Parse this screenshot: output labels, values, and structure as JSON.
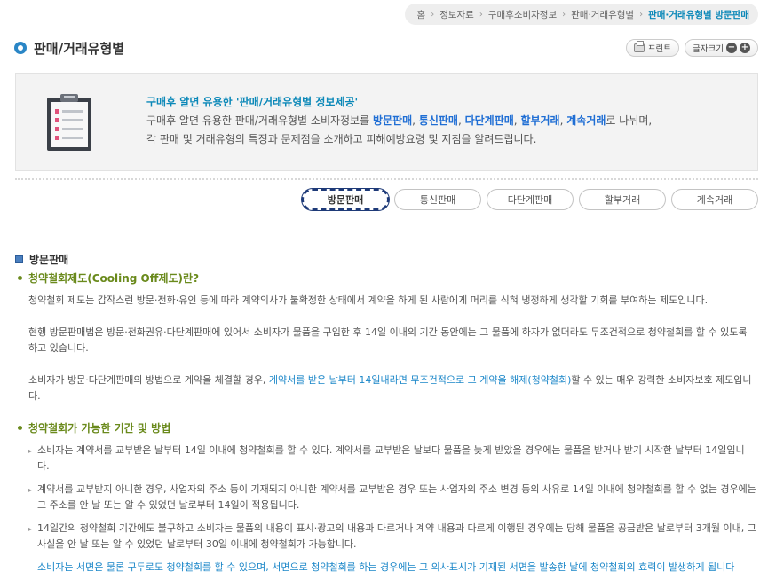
{
  "breadcrumb": {
    "home": "홈",
    "items": [
      "정보자료",
      "구매후소비자정보",
      "판매·거래유형별"
    ],
    "current": "판매·거래유형별 방문판매"
  },
  "header": {
    "title": "판매/거래유형별",
    "print_label": "프린트",
    "font_size_label": "글자크기",
    "zoom_out": "−",
    "zoom_in": "+"
  },
  "info": {
    "headline": "구매후 알면 유용한 '판매/거래유형별 정보제공'",
    "line1_prefix": "구매후 알면 유용한 판매/거래유형별 소비자정보를 ",
    "line1_types": [
      "방문판매",
      "통신판매",
      "다단계판매",
      "할부거래",
      "계속거래"
    ],
    "line1_sep": ", ",
    "line1_suffix": "로 나뉘며,",
    "line2": "각 판매 및 거래유형의 특징과 문제점을 소개하고 피해예방요령 및 지침을 알려드립니다."
  },
  "tabs": [
    "방문판매",
    "통신판매",
    "다단계판매",
    "할부거래",
    "계속거래"
  ],
  "section": {
    "title": "방문판매",
    "sub1": "청약철회제도(Cooling Off제도)란?",
    "p1": "청약철회 제도는 갑작스런 방문·전화·유인 등에 따라 계약의사가 불확정한 상태에서 계약을 하게 된 사람에게 머리를 식혀 냉정하게 생각할 기회를 부여하는 제도입니다.",
    "p2": "현행 방문판매법은 방문·전화권유·다단계판매에 있어서 소비자가 물품을 구입한 후 14일 이내의 기간 동안에는 그 물품에 하자가 없더라도 무조건적으로 청약철회를 할 수 있도록 하고 있습니다.",
    "p3_a": "소비자가 방문·다단계판매의 방법으로 계약을 체결할 경우, ",
    "p3_b": "계약서를 받은 날부터 14일내라면 무조건적으로 그 계약을 해제(청약철회)",
    "p3_c": "할 수 있는 매우 강력한 소비자보호 제도입니다.",
    "sub2": "청약철회가 가능한 기간 및 방법",
    "list": [
      "소비자는 계약서를 교부받은 날부터 14일 이내에 청약철회를 할 수 있다. 계약서를 교부받은 날보다 물품을 늦게 받았을 경우에는 물품을 받거나 받기 시작한 날부터 14일입니다.",
      "계약서를 교부받지 아니한 경우, 사업자의 주소 등이 기재되지 아니한 계약서를 교부받은 경우 또는 사업자의 주소 변경 등의 사유로 14일 이내에 청약철회를 할 수 없는 경우에는 그 주소를 안 날 또는 알 수 있었던 날로부터 14일이 적용됩니다.",
      "14일간의 청약철회 기간에도 불구하고 소비자는 물품의 내용이 표시·광고의 내용과 다르거나 계약 내용과 다르게 이행된 경우에는 당해 물품을 공급받은 날로부터 3개월 이내, 그 사실을 안 날 또는 알 수 있었던 날로부터 30일 이내에 청약철회가 가능합니다."
    ],
    "note": "소비자는 서면은 물론 구두로도 청약철회를 할 수 있으며, 서면으로 청약철회를 하는 경우에는 그 의사표시가 기재된 서면을 발송한 날에 청약철회의 효력이 발생하게 됩니다"
  },
  "colors": {
    "accent": "#0b88b8",
    "link_blue": "#1a86c8",
    "green": "#6a8a1c",
    "tab_active": "#1e3a78"
  }
}
